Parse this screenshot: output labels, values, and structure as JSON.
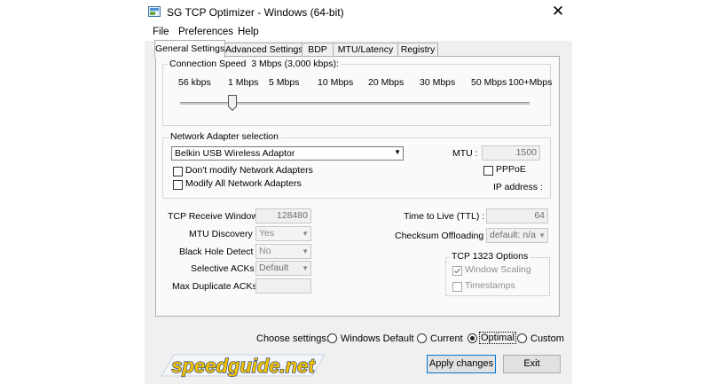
{
  "window": {
    "title": "SG TCP Optimizer - Windows (64-bit)"
  },
  "menu": [
    "File",
    "Preferences",
    "Help"
  ],
  "tabs": [
    {
      "label": "General Settings",
      "active": true
    },
    {
      "label": "Advanced Settings",
      "active": false
    },
    {
      "label": "BDP",
      "active": false
    },
    {
      "label": "MTU/Latency",
      "active": false
    },
    {
      "label": "Registry",
      "active": false
    }
  ],
  "connection_speed": {
    "legend": "Connection Speed",
    "value_text": "3 Mbps (3,000 kbps):",
    "ticks": [
      "56 kbps",
      "1 Mbps",
      "5 Mbps",
      "10 Mbps",
      "20 Mbps",
      "30 Mbps",
      "50 Mbps",
      "100+Mbps"
    ],
    "slider_position": 0.15
  },
  "network_adapter": {
    "legend": "Network Adapter selection",
    "selected": "Belkin USB Wireless Adaptor",
    "dont_modify_label": "Don't modify Network Adapters",
    "modify_all_label": "Modify All Network Adapters",
    "mtu_label": "MTU :",
    "mtu_value": "1500",
    "pppoe_label": "PPPoE",
    "ip_label": "IP address :"
  },
  "settings": {
    "tcp_receive_window_label": "TCP Receive Window :",
    "tcp_receive_window_value": "128480",
    "mtu_discovery_label": "MTU Discovery :",
    "mtu_discovery_value": "Yes",
    "black_hole_label": "Black Hole Detect :",
    "black_hole_value": "No",
    "selective_acks_label": "Selective ACKs :",
    "selective_acks_value": "Default",
    "max_dup_acks_label": "Max Duplicate ACKs :",
    "max_dup_acks_value": "",
    "ttl_label": "Time to Live (TTL) :",
    "ttl_value": "64",
    "checksum_label": "Checksum Offloading :",
    "checksum_value": "default: n/a"
  },
  "tcp1323": {
    "legend": "TCP 1323 Options",
    "window_scaling_label": "Window Scaling",
    "window_scaling_checked": true,
    "timestamps_label": "Timestamps",
    "timestamps_checked": false
  },
  "choose": {
    "label": "Choose settings:",
    "options": [
      "Windows Default",
      "Current",
      "Optimal",
      "Custom"
    ],
    "selected": "Optimal"
  },
  "logo_text": "speedguide.net",
  "buttons": {
    "apply": "Apply changes",
    "exit": "Exit"
  },
  "colors": {
    "logo_fill": "#f5c400",
    "logo_outline": "#1a3a7a",
    "accent": "#0078d7"
  },
  "icons": [
    "app-icon",
    "close-icon",
    "dropdown-arrow-icon"
  ]
}
